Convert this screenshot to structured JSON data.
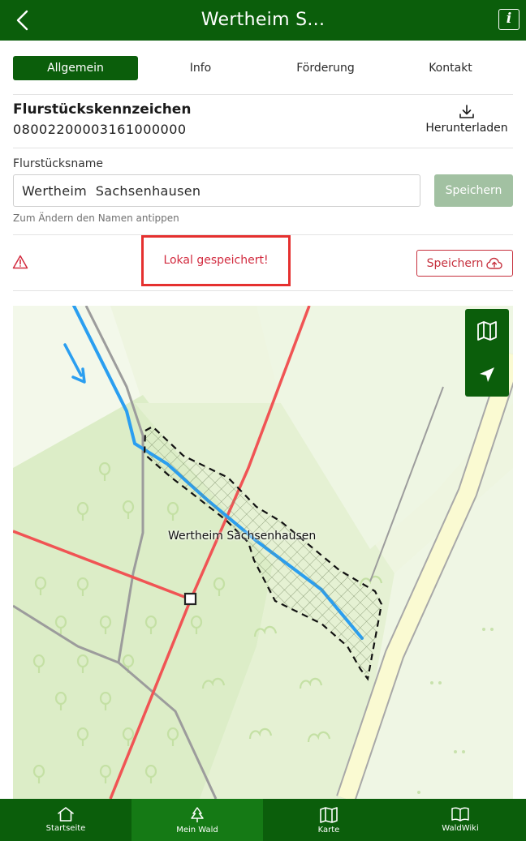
{
  "header": {
    "title": "Wertheim S..."
  },
  "tabs": [
    {
      "label": "Allgemein",
      "active": true
    },
    {
      "label": "Info",
      "active": false
    },
    {
      "label": "Förderung",
      "active": false
    },
    {
      "label": "Kontakt",
      "active": false
    }
  ],
  "parcel": {
    "id_label": "Flurstückskennzeichen",
    "id_value": "08002200003161000000",
    "download_label": "Herunterladen"
  },
  "name": {
    "label": "Flurstücksname",
    "value": "Wertheim  Sachsenhausen",
    "save_label": "Speichern",
    "hint": "Zum Ändern den Namen antippen"
  },
  "status": {
    "message": "Lokal gespeichert!",
    "upload_label": "Speichern",
    "color": "#d22b3f"
  },
  "map": {
    "parcel_label": "Wertheim Sachsenhausen"
  },
  "bottom_nav": [
    {
      "label": "Startseite",
      "icon": "home-icon",
      "active": false
    },
    {
      "label": "Mein Wald",
      "icon": "tree-icon",
      "active": true
    },
    {
      "label": "Karte",
      "icon": "map-icon",
      "active": false
    },
    {
      "label": "WaldWiki",
      "icon": "book-icon",
      "active": false
    }
  ],
  "colors": {
    "brand": "#0b5e0b",
    "brand_active": "#157a15",
    "alert": "#d22b3f"
  }
}
